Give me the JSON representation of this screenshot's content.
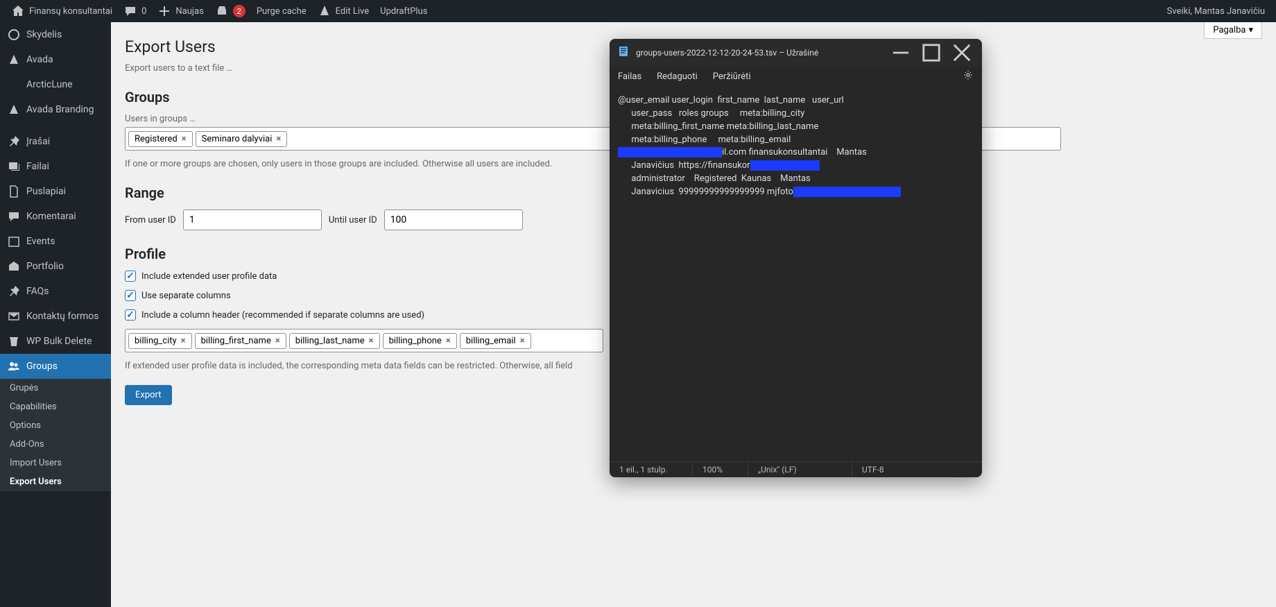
{
  "adminbar": {
    "site_name": "Finansų konsultantai",
    "comments_count": "0",
    "new_label": "Naujas",
    "notif_count": "2",
    "purge": "Purge cache",
    "edit_live": "Edit Live",
    "updraft": "UpdraftPlus",
    "greeting": "Sveiki, Mantas Janavičiu"
  },
  "sidebar": {
    "items": [
      "Skydelis",
      "Avada",
      "ArcticLune",
      "Avada Branding",
      "Įrašai",
      "Failai",
      "Puslapiai",
      "Komentarai",
      "Events",
      "Portfolio",
      "FAQs",
      "Kontaktų formos",
      "WP Bulk Delete",
      "Groups"
    ],
    "submenu": [
      "Grupės",
      "Capabilities",
      "Options",
      "Add-Ons",
      "Import Users",
      "Export Users"
    ]
  },
  "help": "Pagalba",
  "page": {
    "h1": "Export Users",
    "intro": "Export users to a text file …",
    "groups_h": "Groups",
    "groups_label": "Users in groups …",
    "group_tokens": [
      "Registered",
      "Seminaro dalyviai"
    ],
    "groups_hint": "If one or more groups are chosen, only users in those groups are included. Otherwise all users are included.",
    "range_h": "Range",
    "from_label": "From user ID",
    "from_val": "1",
    "until_label": "Until user ID",
    "until_val": "100",
    "profile_h": "Profile",
    "cb1": "Include extended user profile data",
    "cb2": "Use separate columns",
    "cb3": "Include a column header (recommended if separate columns are used)",
    "meta_tokens": [
      "billing_city",
      "billing_first_name",
      "billing_last_name",
      "billing_phone",
      "billing_email"
    ],
    "meta_hint": "If extended user profile data is included, the corresponding meta data fields can be restricted. Otherwise, all field",
    "export_btn": "Export"
  },
  "notepad": {
    "title": "groups-users-2022-12-12-20-24-53.tsv – Užrašinė",
    "menus": [
      "Failas",
      "Redaguoti",
      "Peržiūrėti"
    ],
    "lines": {
      "l1": "@user_email user_login  first_name  last_name   user_url",
      "l2": "      user_pass   roles groups     meta:billing_city",
      "l3": "      meta:billing_first_name meta:billing_last_name",
      "l4": "      meta:billing_phone     meta:billing_email",
      "l5a": "il.com finansukonsultantai    Mantas",
      "l6a": "      Janavičius  https://finansukor",
      "l7": "      administrator    Registered  Kaunas    Mantas",
      "l8a": "      Janavicius  99999999999999999 mjfoto"
    },
    "status": {
      "pos": "1 eil., 1 stulp.",
      "zoom": "100%",
      "eol": "„Unix\" (LF)",
      "enc": "UTF-8"
    }
  }
}
